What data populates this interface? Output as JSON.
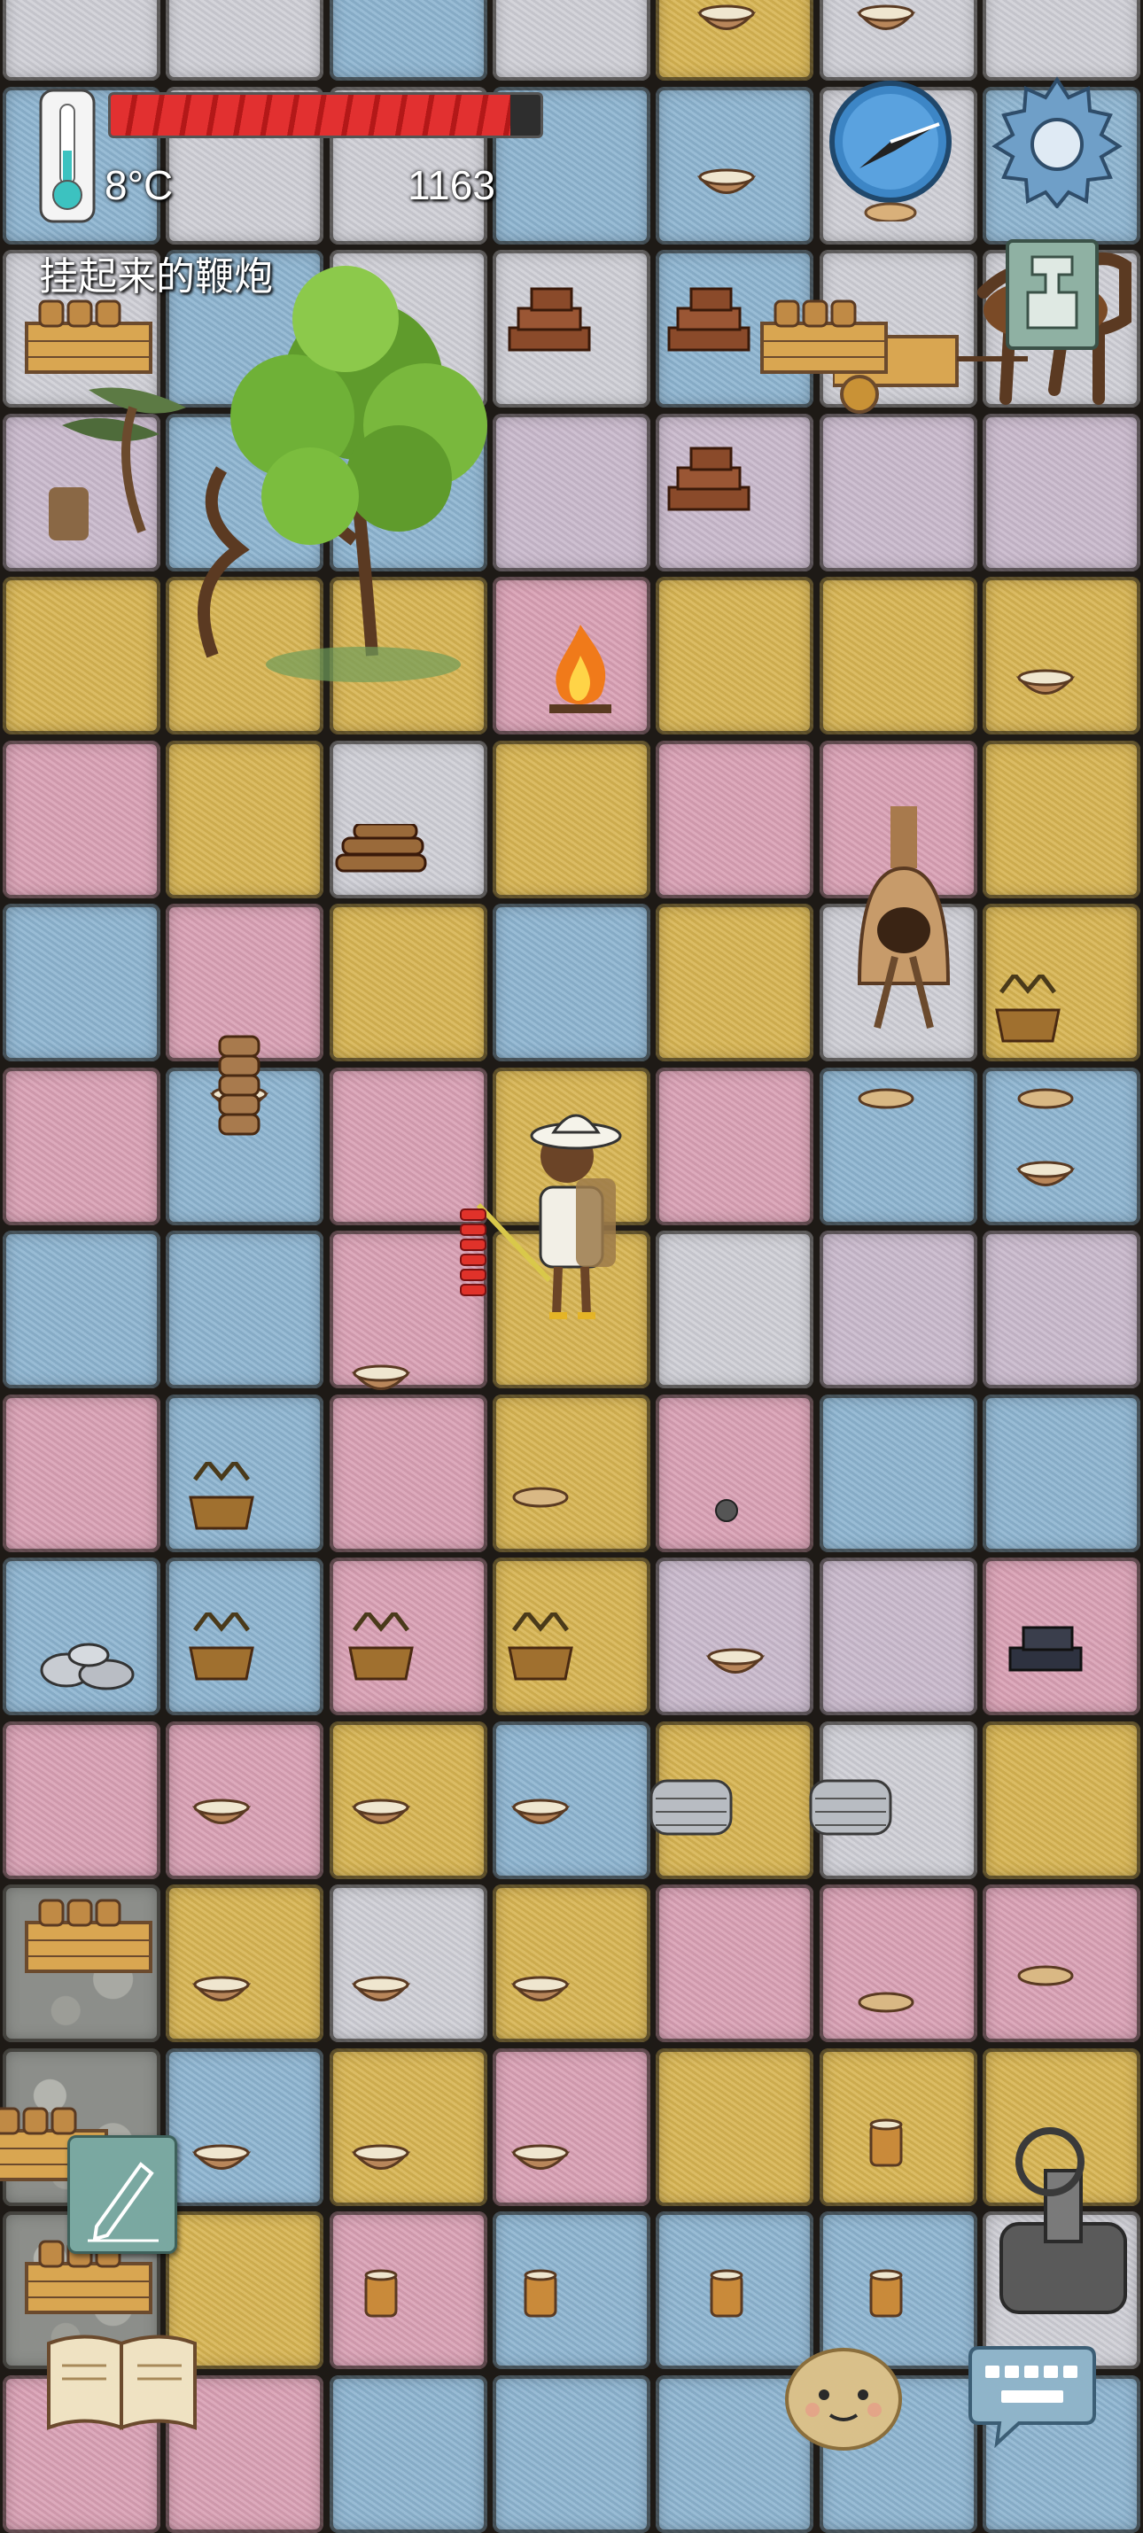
{
  "hud": {
    "temperature": "8°C",
    "score": "1163",
    "held_item_label": "挂起来的鞭炮",
    "health_fraction": 0.93
  },
  "icons": {
    "thermometer": "thermometer-icon",
    "compass": "compass-icon",
    "settings": "gear-icon",
    "notes": "pencil-note-icon",
    "recipe_book": "book-icon",
    "emote": "potato-face-icon",
    "keyboard": "keyboard-chat-icon",
    "coin": "spade-coin-icon"
  },
  "colors": {
    "health_bar": "#d62a2a",
    "tile_pink": "#d9a0b4",
    "tile_yellow": "#d7b452",
    "tile_blue": "#8db4d0",
    "tile_gray": "#cfcfd6"
  }
}
